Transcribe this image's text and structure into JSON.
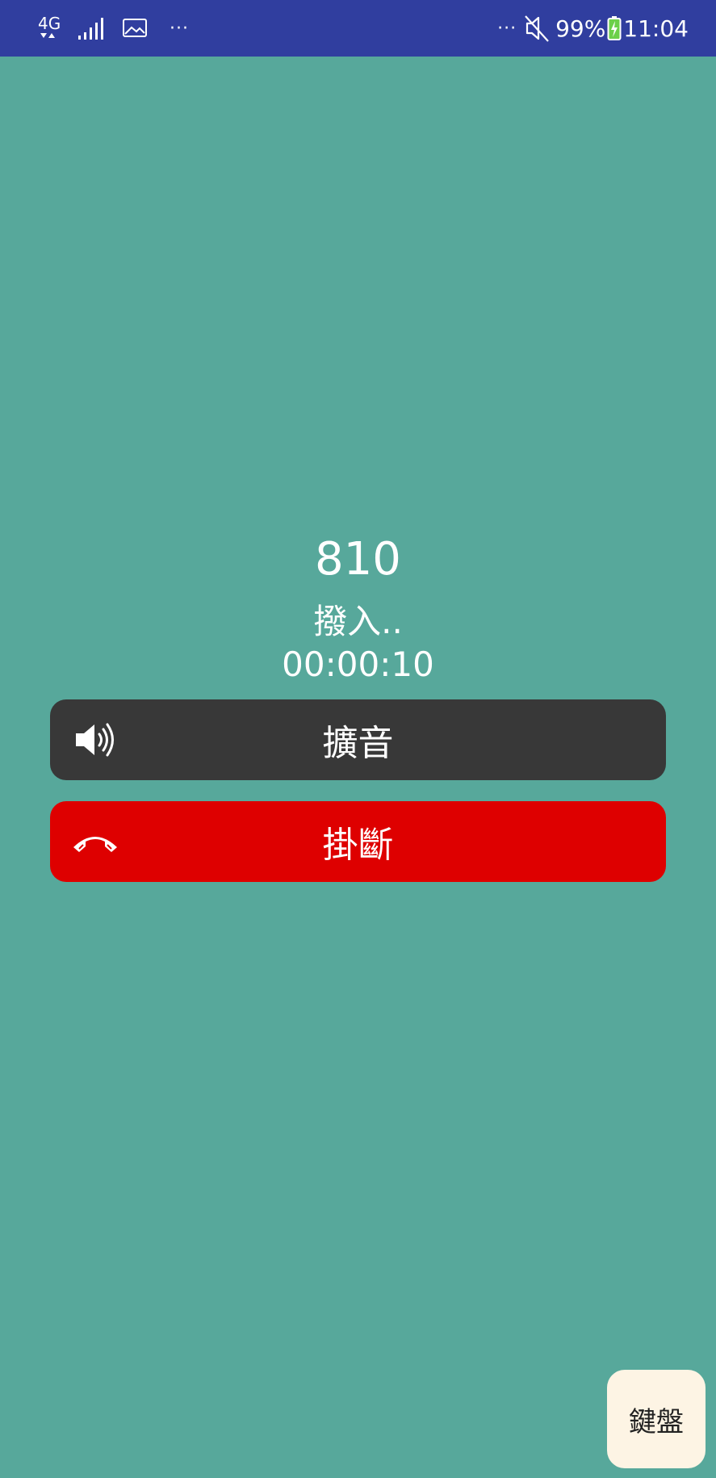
{
  "status_bar": {
    "network": "4G",
    "left_more": "···",
    "right_more": "···",
    "battery_percent": "99%",
    "time": "11:04",
    "icons": {
      "network_type": "4g-data-icon",
      "signal": "signal-strength-icon",
      "notification": "image-notification-icon",
      "mute": "sound-muted-icon",
      "battery": "battery-charging-icon"
    }
  },
  "call": {
    "number": "810",
    "status": "撥入..",
    "timer": "00:00:10"
  },
  "buttons": {
    "speaker": {
      "label": "擴音",
      "icon": "speaker-icon"
    },
    "hangup": {
      "label": "掛斷",
      "icon": "hang-up-phone-icon"
    },
    "keypad": {
      "label": "鍵盤"
    }
  },
  "colors": {
    "background": "#57a89b",
    "status_bar": "#303e9f",
    "speaker_button": "#383838",
    "hangup_button": "#de0000",
    "hangup_icon": "#de0000",
    "keypad_button": "#fdf4e4",
    "battery_charge": "#6cd04a"
  }
}
